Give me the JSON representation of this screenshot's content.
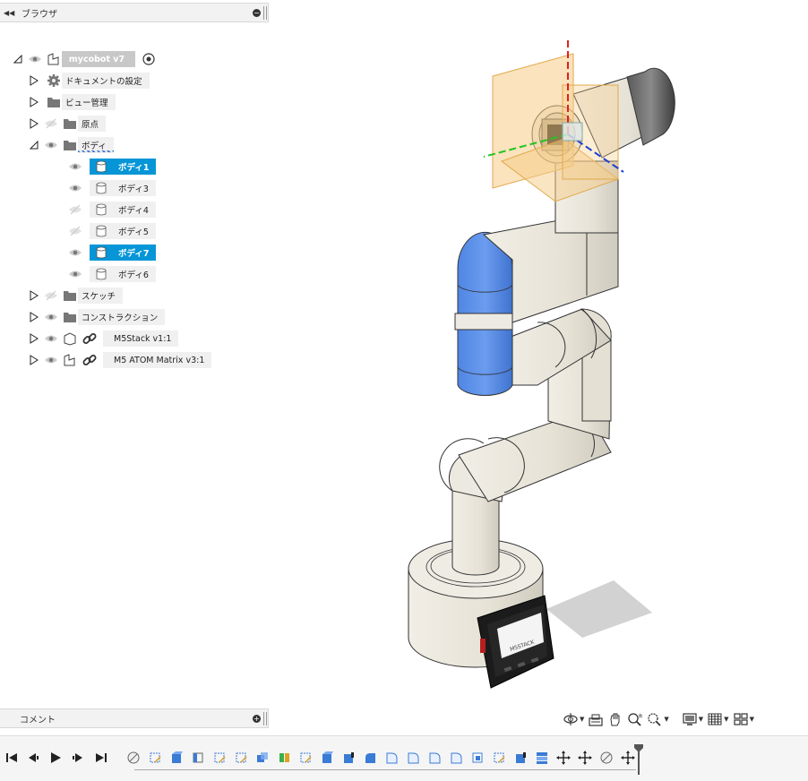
{
  "browser": {
    "title": "ブラウザ",
    "root_label": "mycobot v7",
    "items": [
      {
        "label": "ドキュメントの設定",
        "icon": "gear-icon"
      },
      {
        "label": "ビュー管理",
        "icon": "folder-icon"
      },
      {
        "label": "原点",
        "icon": "folder-icon"
      },
      {
        "label": "ボディ",
        "icon": "folder-icon"
      },
      {
        "label": "スケッチ",
        "icon": "folder-icon"
      },
      {
        "label": "コンストラクション",
        "icon": "folder-icon"
      },
      {
        "label": "M5Stack v1:1",
        "icon": "component-icon"
      },
      {
        "label": "M5 ATOM Matrix v3:1",
        "icon": "component-icon"
      }
    ],
    "bodies": [
      {
        "label": "ボディ1",
        "selected": true,
        "visible": true
      },
      {
        "label": "ボディ3",
        "selected": false,
        "visible": true
      },
      {
        "label": "ボディ4",
        "selected": false,
        "visible": false
      },
      {
        "label": "ボディ5",
        "selected": false,
        "visible": false
      },
      {
        "label": "ボディ7",
        "selected": true,
        "visible": true
      },
      {
        "label": "ボディ6",
        "selected": false,
        "visible": true
      }
    ]
  },
  "comment": {
    "title": "コメント"
  },
  "navbar": {
    "icons": [
      "orbit-icon",
      "look-at-icon",
      "pan-icon",
      "zoom-icon",
      "fit-icon",
      "display-settings-icon",
      "grid-icon",
      "viewports-icon"
    ]
  },
  "colors": {
    "accent": "#0696d7",
    "robot_body": "#ece9e0",
    "selected_body": "#5b8fe6"
  }
}
